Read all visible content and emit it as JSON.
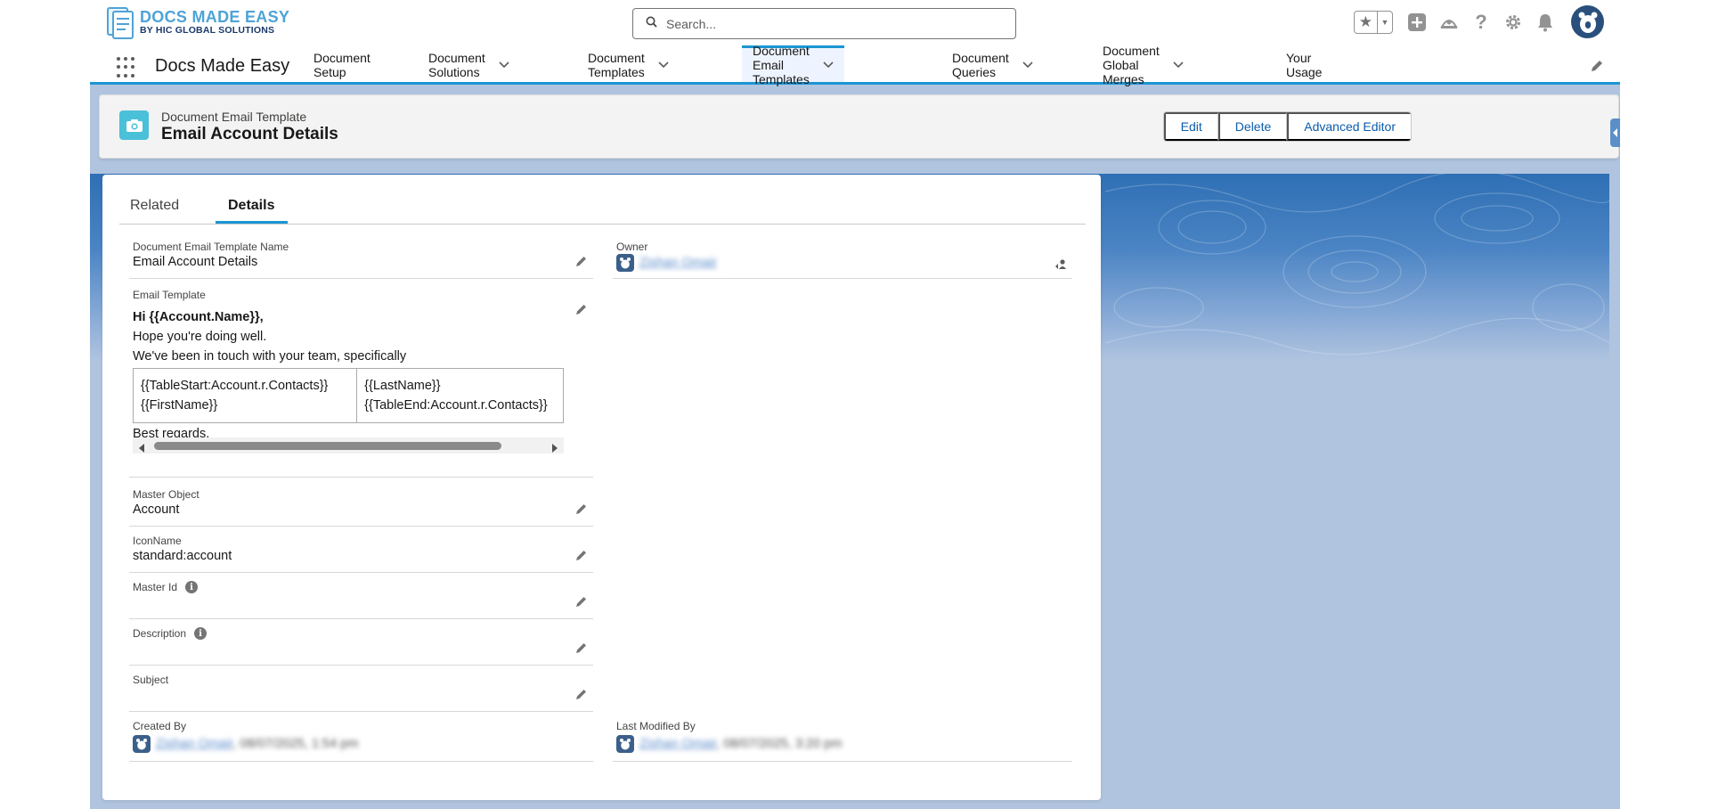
{
  "brand": {
    "logo_main": "DOCS MADE EASY",
    "logo_sub": "BY HIC GLOBAL SOLUTIONS"
  },
  "search": {
    "placeholder": "Search..."
  },
  "app_name": "Docs Made Easy",
  "nav": {
    "items": [
      {
        "label": "Document Setup",
        "has_menu": false,
        "active": false
      },
      {
        "label": "Document Solutions",
        "has_menu": true,
        "active": false
      },
      {
        "label": "Document Templates",
        "has_menu": true,
        "active": false
      },
      {
        "label": "Document Email Templates",
        "has_menu": true,
        "active": true
      },
      {
        "label": "Document Queries",
        "has_menu": true,
        "active": false
      },
      {
        "label": "Document Global Merges",
        "has_menu": true,
        "active": false
      },
      {
        "label": "Your Usage",
        "has_menu": false,
        "active": false
      }
    ]
  },
  "record": {
    "type_label": "Document Email Template",
    "title": "Email Account Details",
    "actions": {
      "edit": "Edit",
      "delete": "Delete",
      "advanced_editor": "Advanced Editor"
    }
  },
  "tabs": {
    "related": "Related",
    "details": "Details"
  },
  "fields": {
    "template_name": {
      "label": "Document Email Template Name",
      "value": "Email Account Details"
    },
    "owner": {
      "label": "Owner",
      "value": "Zishan Omair"
    },
    "email_template": {
      "label": "Email Template",
      "greeting": "Hi {{Account.Name}},",
      "line1": "Hope you're doing well.",
      "line2": "We've been in touch with your team, specifically",
      "table": {
        "c1_line1": "{{TableStart:Account.r.Contacts}}",
        "c1_line2": "{{FirstName}}",
        "c2_line1": "{{LastName}}",
        "c2_line2": "{{TableEnd:Account.r.Contacts}}"
      },
      "closing": "Best regards."
    },
    "master_object": {
      "label": "Master Object",
      "value": "Account"
    },
    "icon_name": {
      "label": "IconName",
      "value": "standard:account"
    },
    "master_id": {
      "label": "Master Id",
      "value": ""
    },
    "description": {
      "label": "Description",
      "value": ""
    },
    "subject": {
      "label": "Subject",
      "value": ""
    },
    "created_by": {
      "label": "Created By",
      "user": "Zishan Omair",
      "date": ", 08/07/2025, 1:54 pm"
    },
    "last_modified_by": {
      "label": "Last Modified By",
      "user": "Zishan Omair",
      "date": ", 08/07/2025, 3:20 pm"
    }
  },
  "colors": {
    "accent": "#1b96d3",
    "link": "#0b5cab",
    "record_icon": "#4bc0d9",
    "app_background": "#b0c4df"
  },
  "icons": [
    "search-icon",
    "star-icon",
    "add-icon",
    "trailhead-icon",
    "help-icon",
    "gear-icon",
    "bell-icon",
    "app-launcher-icon",
    "pencil-icon",
    "camera-icon",
    "info-icon",
    "change-owner-icon"
  ]
}
